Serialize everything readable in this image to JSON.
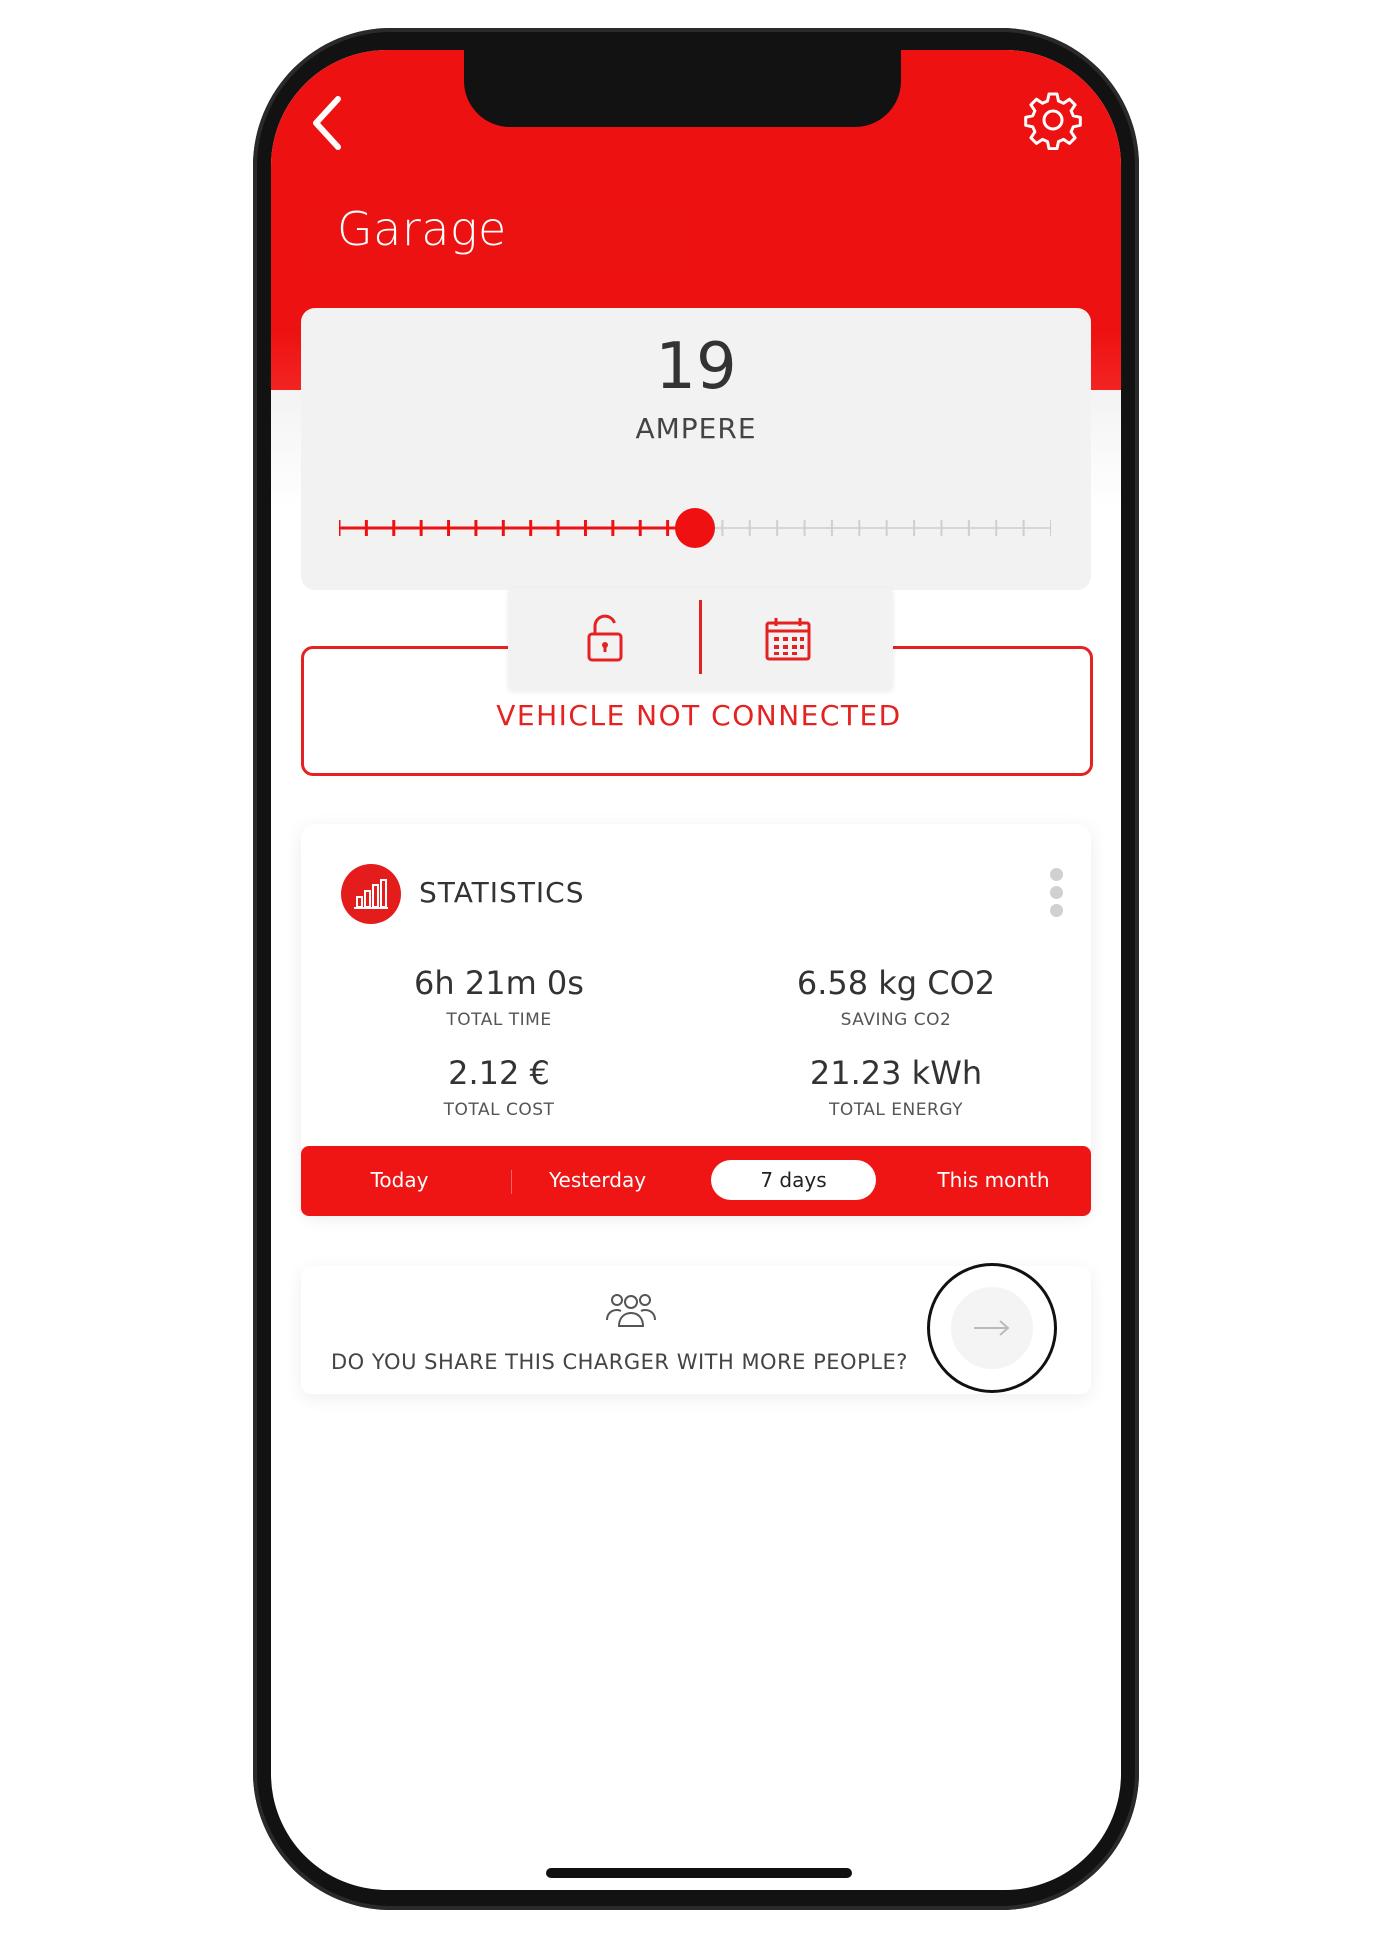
{
  "header": {
    "title": "Garage",
    "back_icon": "chevron-left-icon",
    "settings_icon": "gear-icon"
  },
  "current": {
    "value": "19",
    "unit": "AMPERE",
    "slider_fraction": 0.5
  },
  "connection": {
    "status": "VEHICLE NOT CONNECTED",
    "actions": [
      "unlock-icon",
      "calendar-icon"
    ]
  },
  "statistics": {
    "title": "STATISTICS",
    "items": [
      {
        "value": "6h 21m 0s",
        "label": "TOTAL TIME"
      },
      {
        "value": "6.58 kg CO2",
        "label": "SAVING CO2"
      },
      {
        "value": "2.12 €",
        "label": "TOTAL COST"
      },
      {
        "value": "21.23 kWh",
        "label": "TOTAL ENERGY"
      }
    ],
    "periods": [
      "Today",
      "Yesterday",
      "7 days",
      "This month"
    ],
    "active_period": "7 days"
  },
  "share": {
    "text": "DO YOU SHARE THIS CHARGER WITH MORE PEOPLE?",
    "icon": "people-icon",
    "action_icon": "arrow-right-icon"
  },
  "colors": {
    "accent": "#ee1111",
    "text": "#333333",
    "card": "#f2f2f2"
  }
}
